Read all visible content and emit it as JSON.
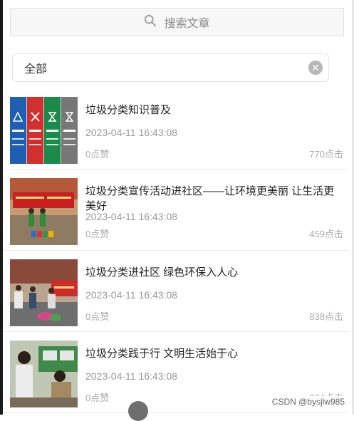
{
  "search": {
    "label": "搜索文章"
  },
  "filter": {
    "value": "全部"
  },
  "articles": [
    {
      "title": "垃圾分类知识普及",
      "date": "2023-04-11 16:43:08",
      "likes": "0点赞",
      "clicks": "770点击"
    },
    {
      "title": "垃圾分类宣传活动进社区——让环境更美丽 让生活更美好",
      "date": "2023-04-11 16:43:08",
      "likes": "0点赞",
      "clicks": "459点击"
    },
    {
      "title": "垃圾分类进社区 绿色环保入人心",
      "date": "2023-04-11 16:43:08",
      "likes": "0点赞",
      "clicks": "838点击"
    },
    {
      "title": "垃圾分类践于行 文明生活始于心",
      "date": "2023-04-11 16:43:08",
      "likes": "0点赞",
      "clicks": "274点击"
    }
  ],
  "watermark": "CSDN @bysjlw985"
}
